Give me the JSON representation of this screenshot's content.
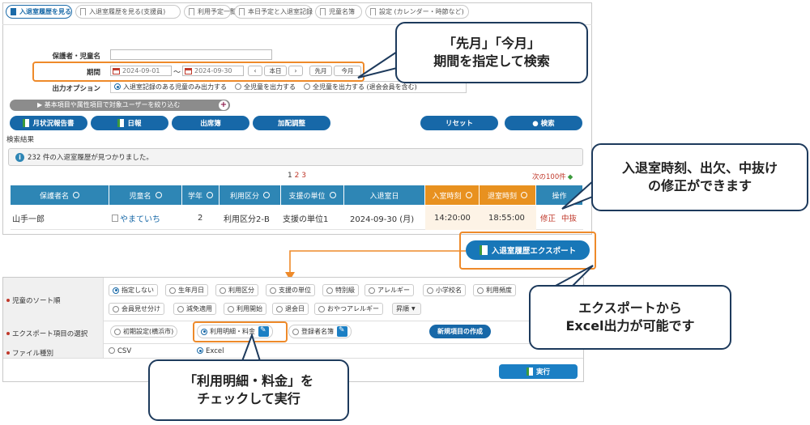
{
  "tabs": [
    {
      "label": "入退室履歴を見る"
    },
    {
      "label": "入退室履歴を見る(支援員)"
    },
    {
      "label": "利用予定一覧"
    },
    {
      "label": "本日予定と入退室記録"
    },
    {
      "label": "児童名簿"
    },
    {
      "label": "設定 (カレンダー・時節など)"
    }
  ],
  "form": {
    "guardian_label": "保護者・児童名",
    "period_label": "期間",
    "date_from": "2024-09-01",
    "tilde": "〜",
    "date_to": "2024-09-30",
    "prev": "‹",
    "today": "本日",
    "next": "›",
    "last_month": "先月",
    "this_month": "今月",
    "output_label": "出力オプション",
    "output_options": [
      "入退室記録のある児童のみ出力する",
      "全児童を出力する",
      "全児童を出力する (退会会員を含む)"
    ],
    "filter_bar": "▶ 基本項目や属性項目で対象ユーザーを絞り込む"
  },
  "buttons": {
    "monthly": "月状況報告書",
    "daily": "日報",
    "attendance": "出席簿",
    "addition": "加配調整",
    "reset": "リセット",
    "search": "● 検索"
  },
  "results": {
    "section": "検索結果",
    "message": "232 件の入退室履歴が見つかりました。",
    "pages": [
      "1",
      "2",
      "3"
    ],
    "next100": "次の100件"
  },
  "table": {
    "headers": [
      "保護者名",
      "児童名",
      "学年",
      "利用区分",
      "支援の単位",
      "入退室日",
      "入室時刻",
      "退室時刻",
      "操作"
    ],
    "row": {
      "guardian": "山手一郎",
      "child": "やまていち",
      "grade": "2",
      "category": "利用区分2-B",
      "unit": "支援の単位1",
      "date": "2024-09-30 (月)",
      "in": "14:20:00",
      "out": "18:55:00",
      "fix": "修正",
      "leave": "中抜"
    }
  },
  "export_button": "入退室履歴エクスポート",
  "export": {
    "sort_label": "児童のソート順",
    "sort_row1": [
      "指定しない",
      "生年月日",
      "利用区分",
      "支援の単位",
      "特別級",
      "アレルギー",
      "小学校名",
      "利用頻度"
    ],
    "sort_row2": [
      "会員見せ分け",
      "減免適用",
      "利用開始",
      "退会日",
      "おやつアレルギー"
    ],
    "sort_dir": "昇順",
    "items_label": "エクスポート項目の選択",
    "items": [
      "初期設定(横浜市)",
      "利用明細・料金",
      "登録者名簿"
    ],
    "new_item": "新規項目の作成",
    "type_label": "ファイル種別",
    "types": [
      "CSV",
      "Excel"
    ],
    "run": "実行"
  },
  "callouts": {
    "period": [
      "「先月」「今月」",
      "期間を指定して検索"
    ],
    "edit": [
      "入退室時刻、出欠、中抜け",
      "の修正ができます"
    ],
    "excel": [
      "エクスポートから",
      "Excel出力が可能です"
    ],
    "check": [
      "「利用明細・料金」を",
      "チェックして実行"
    ]
  },
  "colors": {
    "primary": "#1768a8",
    "header": "#2e86b5",
    "accent": "#e8911f",
    "callout_border": "#1d3a5c",
    "highlight": "#ee8a2a"
  }
}
